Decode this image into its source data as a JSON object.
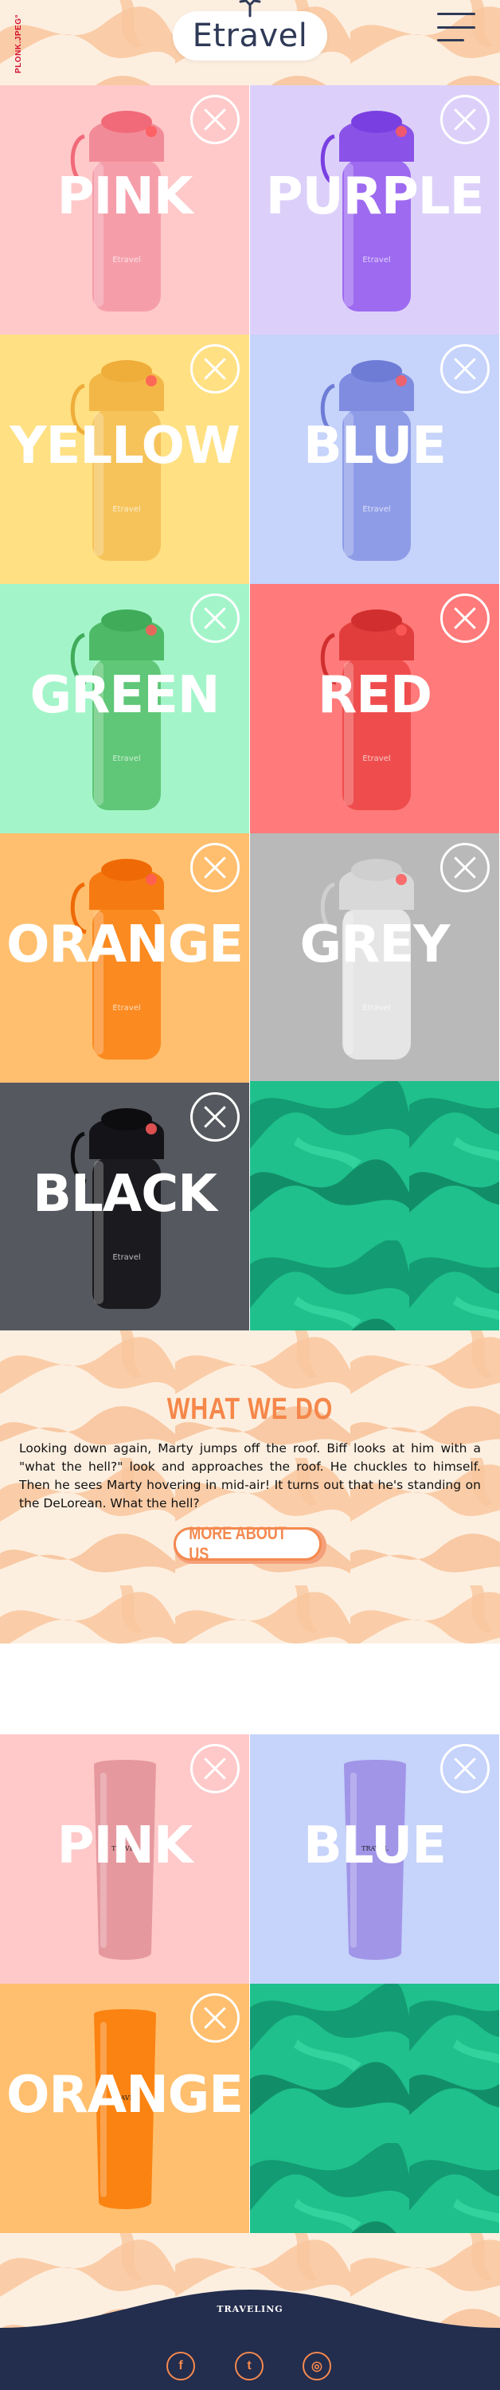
{
  "header": {
    "side_tag": "PLONK.JPEG°",
    "logo": "Etravel",
    "colors": {
      "brand_navy": "#2f3a57",
      "side_tag": "#d1122f"
    }
  },
  "colors_grid": [
    {
      "label": "PINK",
      "bg": "#ffc9c9",
      "body": "#f59eaa",
      "lid": "#f28b98",
      "cap": "#f06a7a"
    },
    {
      "label": "PURPLE",
      "bg": "#dcd0fa",
      "body": "#9d6af0",
      "lid": "#8b52e8",
      "cap": "#7a3fe0"
    },
    {
      "label": "YELLOW",
      "bg": "#ffe083",
      "body": "#f6c35a",
      "lid": "#f3b748",
      "cap": "#efad3a"
    },
    {
      "label": "BLUE",
      "bg": "#c6d3fb",
      "body": "#8e9ce8",
      "lid": "#7f8ce0",
      "cap": "#6f7cd6"
    },
    {
      "label": "GREEN",
      "bg": "#a3f5c9",
      "body": "#5fc777",
      "lid": "#4eba68",
      "cap": "#40ac5a"
    },
    {
      "label": "RED",
      "bg": "#ff7a7a",
      "body": "#ef4d4d",
      "lid": "#e23d3d",
      "cap": "#d12f2f"
    },
    {
      "label": "ORANGE",
      "bg": "#ffbf6e",
      "body": "#fb8a20",
      "lid": "#f67a12",
      "cap": "#ef6a06"
    },
    {
      "label": "GREY",
      "bg": "#b9b9b9",
      "body": "#e5e5e5",
      "lid": "#d8d8d8",
      "cap": "#cfcfcf"
    },
    {
      "label": "BLACK",
      "bg": "#55585e",
      "body": "#1b1b1f",
      "lid": "#141418",
      "cap": "#0d0d10"
    }
  ],
  "about": {
    "title": "WHAT WE DO",
    "text": "Looking down again, Marty jumps off the roof. Biff looks at him with a \"what the hell?\" look and approaches the roof. He chuckles to himself. Then he sees Marty hovering in mid-air! It turns out that he's standing on the DeLorean. What the hell?",
    "button": "MORE ABOUT US",
    "accent": "#f5874a"
  },
  "tumblers": [
    {
      "label": "PINK",
      "bg": "#ffc9c9",
      "body": "#e5999f"
    },
    {
      "label": "BLUE",
      "bg": "#c6d3fb",
      "body": "#a195e8"
    },
    {
      "label": "ORANGE",
      "bg": "#ffbf6e",
      "body": "#fb8312"
    }
  ],
  "accent_green": "#22c48e",
  "footer": {
    "brand": "TRAVELING",
    "bar_color": "#232d4d",
    "social_icons": [
      "facebook-icon",
      "twitter-icon",
      "instagram-icon"
    ],
    "social_glyphs": [
      "f",
      "t",
      "◎"
    ]
  }
}
